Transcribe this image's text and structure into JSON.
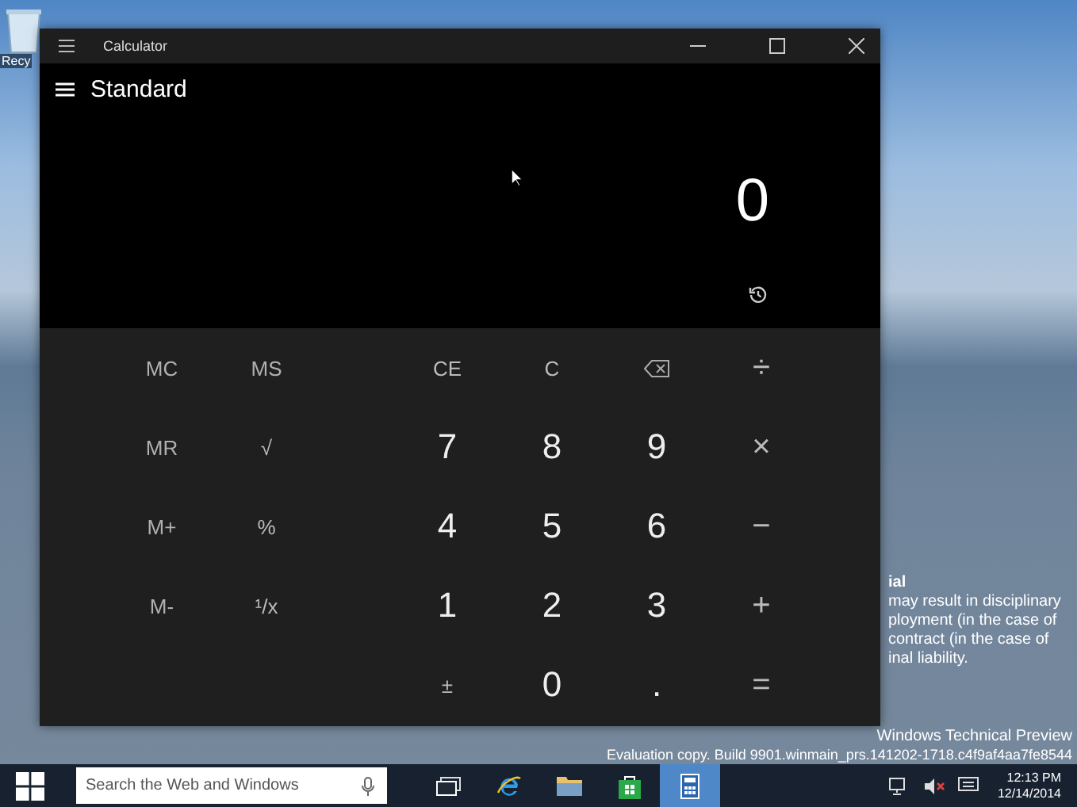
{
  "desktop": {
    "icons": [
      {
        "label": "Recy"
      }
    ],
    "notice_lines": [
      "ial",
      "may result in disciplinary",
      "ployment (in the case of",
      "contract (in the case of",
      "inal liability."
    ],
    "edition": "Windows Technical Preview",
    "build": "Evaluation copy. Build 9901.winmain_prs.141202-1718.c4f9af4aa7fe8544"
  },
  "window": {
    "title": "Calculator",
    "mode": "Standard",
    "display": "0",
    "rows": [
      {
        "left": [
          {
            "label": "MC",
            "kind": "memory"
          },
          {
            "label": "MS",
            "kind": "memory"
          }
        ],
        "right": [
          {
            "label": "CE",
            "kind": "function"
          },
          {
            "label": "C",
            "kind": "function"
          },
          {
            "kind": "backspace"
          },
          {
            "label": "÷",
            "kind": "operator"
          }
        ]
      },
      {
        "left": [
          {
            "label": "MR",
            "kind": "memory"
          },
          {
            "label": "√",
            "kind": "function"
          }
        ],
        "right": [
          {
            "label": "7",
            "kind": "digit"
          },
          {
            "label": "8",
            "kind": "digit"
          },
          {
            "label": "9",
            "kind": "digit"
          },
          {
            "label": "×",
            "kind": "operator"
          }
        ]
      },
      {
        "left": [
          {
            "label": "M+",
            "kind": "memory"
          },
          {
            "label": "%",
            "kind": "function"
          }
        ],
        "right": [
          {
            "label": "4",
            "kind": "digit"
          },
          {
            "label": "5",
            "kind": "digit"
          },
          {
            "label": "6",
            "kind": "digit"
          },
          {
            "label": "−",
            "kind": "operator"
          }
        ]
      },
      {
        "left": [
          {
            "label": "M-",
            "kind": "memory"
          },
          {
            "label": "¹/x",
            "kind": "function"
          }
        ],
        "right": [
          {
            "label": "1",
            "kind": "digit"
          },
          {
            "label": "2",
            "kind": "digit"
          },
          {
            "label": "3",
            "kind": "digit"
          },
          {
            "label": "+",
            "kind": "operator"
          }
        ]
      },
      {
        "left": [],
        "right": [
          {
            "label": "±",
            "kind": "function"
          },
          {
            "label": "0",
            "kind": "digit"
          },
          {
            "label": ".",
            "kind": "digit"
          },
          {
            "label": "=",
            "kind": "operator"
          }
        ]
      }
    ]
  },
  "taskbar": {
    "search": {
      "placeholder": "Search the Web and Windows"
    },
    "apps": [
      {
        "kind": "task-view",
        "selected": false
      },
      {
        "kind": "browser",
        "selected": false
      },
      {
        "kind": "folder",
        "selected": false
      },
      {
        "kind": "store",
        "selected": false
      },
      {
        "kind": "calculator",
        "selected": true
      }
    ],
    "time": "12:13 PM",
    "date": "12/14/2014"
  }
}
